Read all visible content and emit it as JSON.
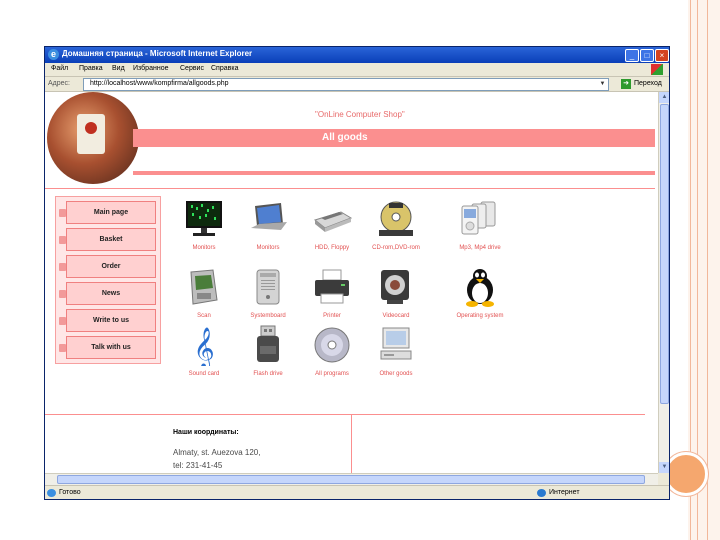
{
  "window": {
    "title": "Домашняя страница - Microsoft Internet Explorer",
    "menu": [
      "Файл",
      "Правка",
      "Вид",
      "Избранное",
      "Сервис",
      "Справка"
    ],
    "address_label": "Адрес:",
    "address": "http://localhost/www/kompfirma/allgoods.php",
    "go_label": "Переход",
    "status_left": "Готово",
    "status_right": "Интернет"
  },
  "site": {
    "slogan": "\"OnLine Computer Shop\"",
    "page_heading": "All goods"
  },
  "nav": [
    "Main page",
    "Basket",
    "Order",
    "News",
    "Write to us",
    "Talk with us"
  ],
  "products": [
    {
      "label": "Monitors",
      "icon": "matrix-monitor-icon"
    },
    {
      "label": "Monitors",
      "icon": "laptop-icon"
    },
    {
      "label": "HDD, Floppy",
      "icon": "scanner-icon"
    },
    {
      "label": "CD-rom,DVD-rom",
      "icon": "dvd-drive-icon"
    },
    {
      "label": "Mp3, Mp4 drive",
      "icon": "ipod-icon"
    },
    {
      "label": "Scan",
      "icon": "handheld-scanner-icon"
    },
    {
      "label": "Systemboard",
      "icon": "computer-case-icon"
    },
    {
      "label": "Printer",
      "icon": "printer-icon"
    },
    {
      "label": "Videocard",
      "icon": "webcam-icon"
    },
    {
      "label": "Operating system",
      "icon": "tux-penguin-icon"
    },
    {
      "label": "Sound card",
      "icon": "treble-clef-icon"
    },
    {
      "label": "Flash drive",
      "icon": "flash-drive-icon"
    },
    {
      "label": "All programs",
      "icon": "cd-disc-icon"
    },
    {
      "label": "Other goods",
      "icon": "desktop-computer-icon"
    }
  ],
  "footer": {
    "title": "Наши координаты:",
    "address": "Almaty, st. Auezova 120,",
    "tel": "tel: 231-41-45"
  },
  "colors": {
    "accent": "#fb8f8f",
    "label": "#e25050",
    "slide_accent": "#f5a76e"
  }
}
